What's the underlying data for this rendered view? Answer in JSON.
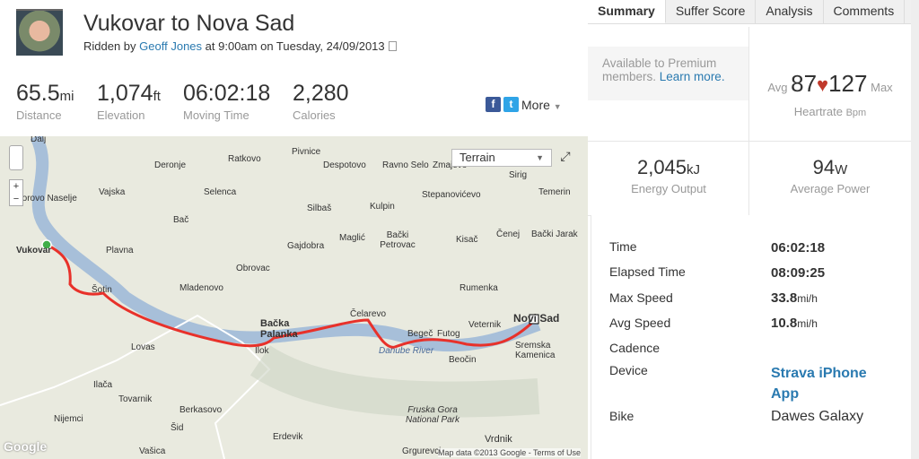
{
  "activity": {
    "title": "Vukovar to Nova Sad",
    "ridden_by": "Ridden by",
    "athlete": "Geoff Jones",
    "when": "at 9:00am on Tuesday, 24/09/2013"
  },
  "stats": [
    {
      "value": "65.5",
      "unit": "mi",
      "label": "Distance"
    },
    {
      "value": "1,074",
      "unit": "ft",
      "label": "Elevation"
    },
    {
      "value": "06:02:18",
      "unit": "",
      "label": "Moving Time"
    },
    {
      "value": "2,280",
      "unit": "",
      "label": "Calories"
    }
  ],
  "share": {
    "facebook": "f",
    "twitter": "t",
    "more": "More"
  },
  "tabs": [
    "Summary",
    "Suffer Score",
    "Analysis",
    "Comments"
  ],
  "premium": {
    "text": "Available to Premium members.",
    "link": "Learn more."
  },
  "heartrate": {
    "avg_label": "Avg",
    "avg": "87",
    "max": "127",
    "max_label": "Max",
    "label": "Heartrate",
    "unit": "Bpm",
    "heart_color": "#c0392b"
  },
  "energy": {
    "value": "2,045",
    "unit": "kJ",
    "label": "Energy Output"
  },
  "power": {
    "value": "94",
    "unit": "W",
    "label": "Average Power"
  },
  "details": [
    {
      "label": "Time",
      "value": "06:02:18",
      "unit": ""
    },
    {
      "label": "Elapsed Time",
      "value": "08:09:25",
      "unit": ""
    },
    {
      "label": "Max Speed",
      "value": "33.8",
      "unit": "mi/h"
    },
    {
      "label": "Avg Speed",
      "value": "10.8",
      "unit": "mi/h"
    },
    {
      "label": "Cadence",
      "value": "",
      "unit": ""
    },
    {
      "label": "Device",
      "value": "Strava iPhone App",
      "unit": ""
    },
    {
      "label": "Bike",
      "value": "Dawes Galaxy",
      "unit": ""
    }
  ],
  "map": {
    "type_select": "Terrain",
    "attribution": "Map data ©2013 Google - Terms of Use",
    "logo": "Google",
    "route_color": "#e8312a",
    "towns": [
      "Dalj",
      "Deronje",
      "Ratkovo",
      "Pivnice",
      "Despotovo",
      "Ravno Selo",
      "Zmajevo",
      "Sirig",
      "Vajska",
      "Selenca",
      "Stepanovićevo",
      "Temerin",
      "Borovo Naselje",
      "Silbaš",
      "Kulpin",
      "Bač",
      "Bački Petrovac",
      "Maglić",
      "Kisač",
      "Čenej",
      "Bački Jarak",
      "Vukovar",
      "Gajdobra",
      "Plavna",
      "Obrovac",
      "Šotin",
      "Mladenovo",
      "Rumenka",
      "Bačka Palanka",
      "Čelarevo",
      "Novi Sad",
      "Lovas",
      "Ilok",
      "Begeč",
      "Futog",
      "Veternik",
      "Sremska Kamenica",
      "Danube River",
      "Beočin",
      "Ilača",
      "Tovarnik",
      "Berkasovo",
      "Fruska Gora National Park",
      "Nijemci",
      "Šid",
      "Erdevik",
      "Vrdnik",
      "Vašica",
      "Grgurevci"
    ]
  }
}
